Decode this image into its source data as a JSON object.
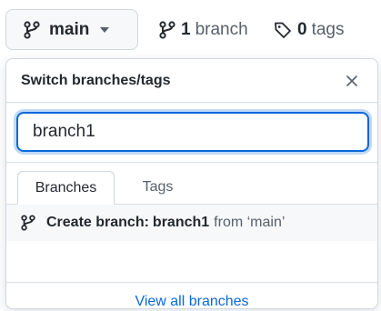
{
  "repo_nav": {
    "current_branch": "main",
    "branch_count": "1",
    "branch_count_label": "branch",
    "tag_count": "0",
    "tag_count_label": "tags"
  },
  "dropdown": {
    "title": "Switch branches/tags",
    "filter_value": "branch1",
    "tabs": [
      {
        "label": "Branches",
        "active": true
      },
      {
        "label": "Tags",
        "active": false
      }
    ],
    "create": {
      "prefix": "Create branch:",
      "branch_name": "branch1",
      "suffix": "from ‘main’"
    },
    "footer_link": "View all branches"
  },
  "colors": {
    "accent": "#0969da",
    "text": "#24292f",
    "muted": "#57606a",
    "border": "#d0d7de",
    "subtle_bg": "#f6f8fa"
  }
}
